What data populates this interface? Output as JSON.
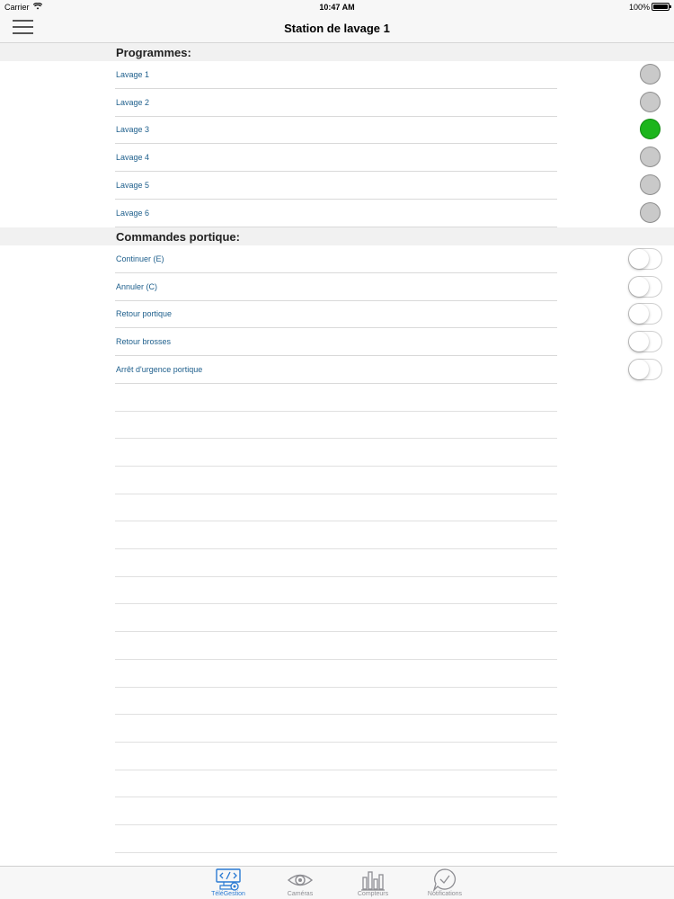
{
  "status_bar": {
    "carrier": "Carrier",
    "time": "10:47 AM",
    "battery": "100%"
  },
  "nav": {
    "title": "Station de lavage 1"
  },
  "programmes": {
    "header": "Programmes:",
    "items": [
      {
        "label": "Lavage 1",
        "active": false
      },
      {
        "label": "Lavage 2",
        "active": false
      },
      {
        "label": "Lavage 3",
        "active": true
      },
      {
        "label": "Lavage 4",
        "active": false
      },
      {
        "label": "Lavage 5",
        "active": false
      },
      {
        "label": "Lavage 6",
        "active": false
      }
    ]
  },
  "commandes": {
    "header": "Commandes portique:",
    "items": [
      {
        "label": "Continuer (E)",
        "on": false
      },
      {
        "label": "Annuler (C)",
        "on": false
      },
      {
        "label": "Retour portique",
        "on": false
      },
      {
        "label": "Retour brosses",
        "on": false
      },
      {
        "label": "Arrêt d'urgence portique",
        "on": false
      }
    ]
  },
  "tabs": [
    {
      "label": "TéléGestion",
      "icon": "telegestion-icon",
      "selected": true
    },
    {
      "label": "Caméras",
      "icon": "eye-icon",
      "selected": false
    },
    {
      "label": "Compteurs",
      "icon": "bar-chart-icon",
      "selected": false
    },
    {
      "label": "Notifications",
      "icon": "chat-check-icon",
      "selected": false
    }
  ],
  "colors": {
    "active_indicator": "#1cb51c",
    "inactive_indicator": "#c9c9c9",
    "label_text": "#1e5f8c",
    "tab_selected": "#2a7ad3"
  }
}
